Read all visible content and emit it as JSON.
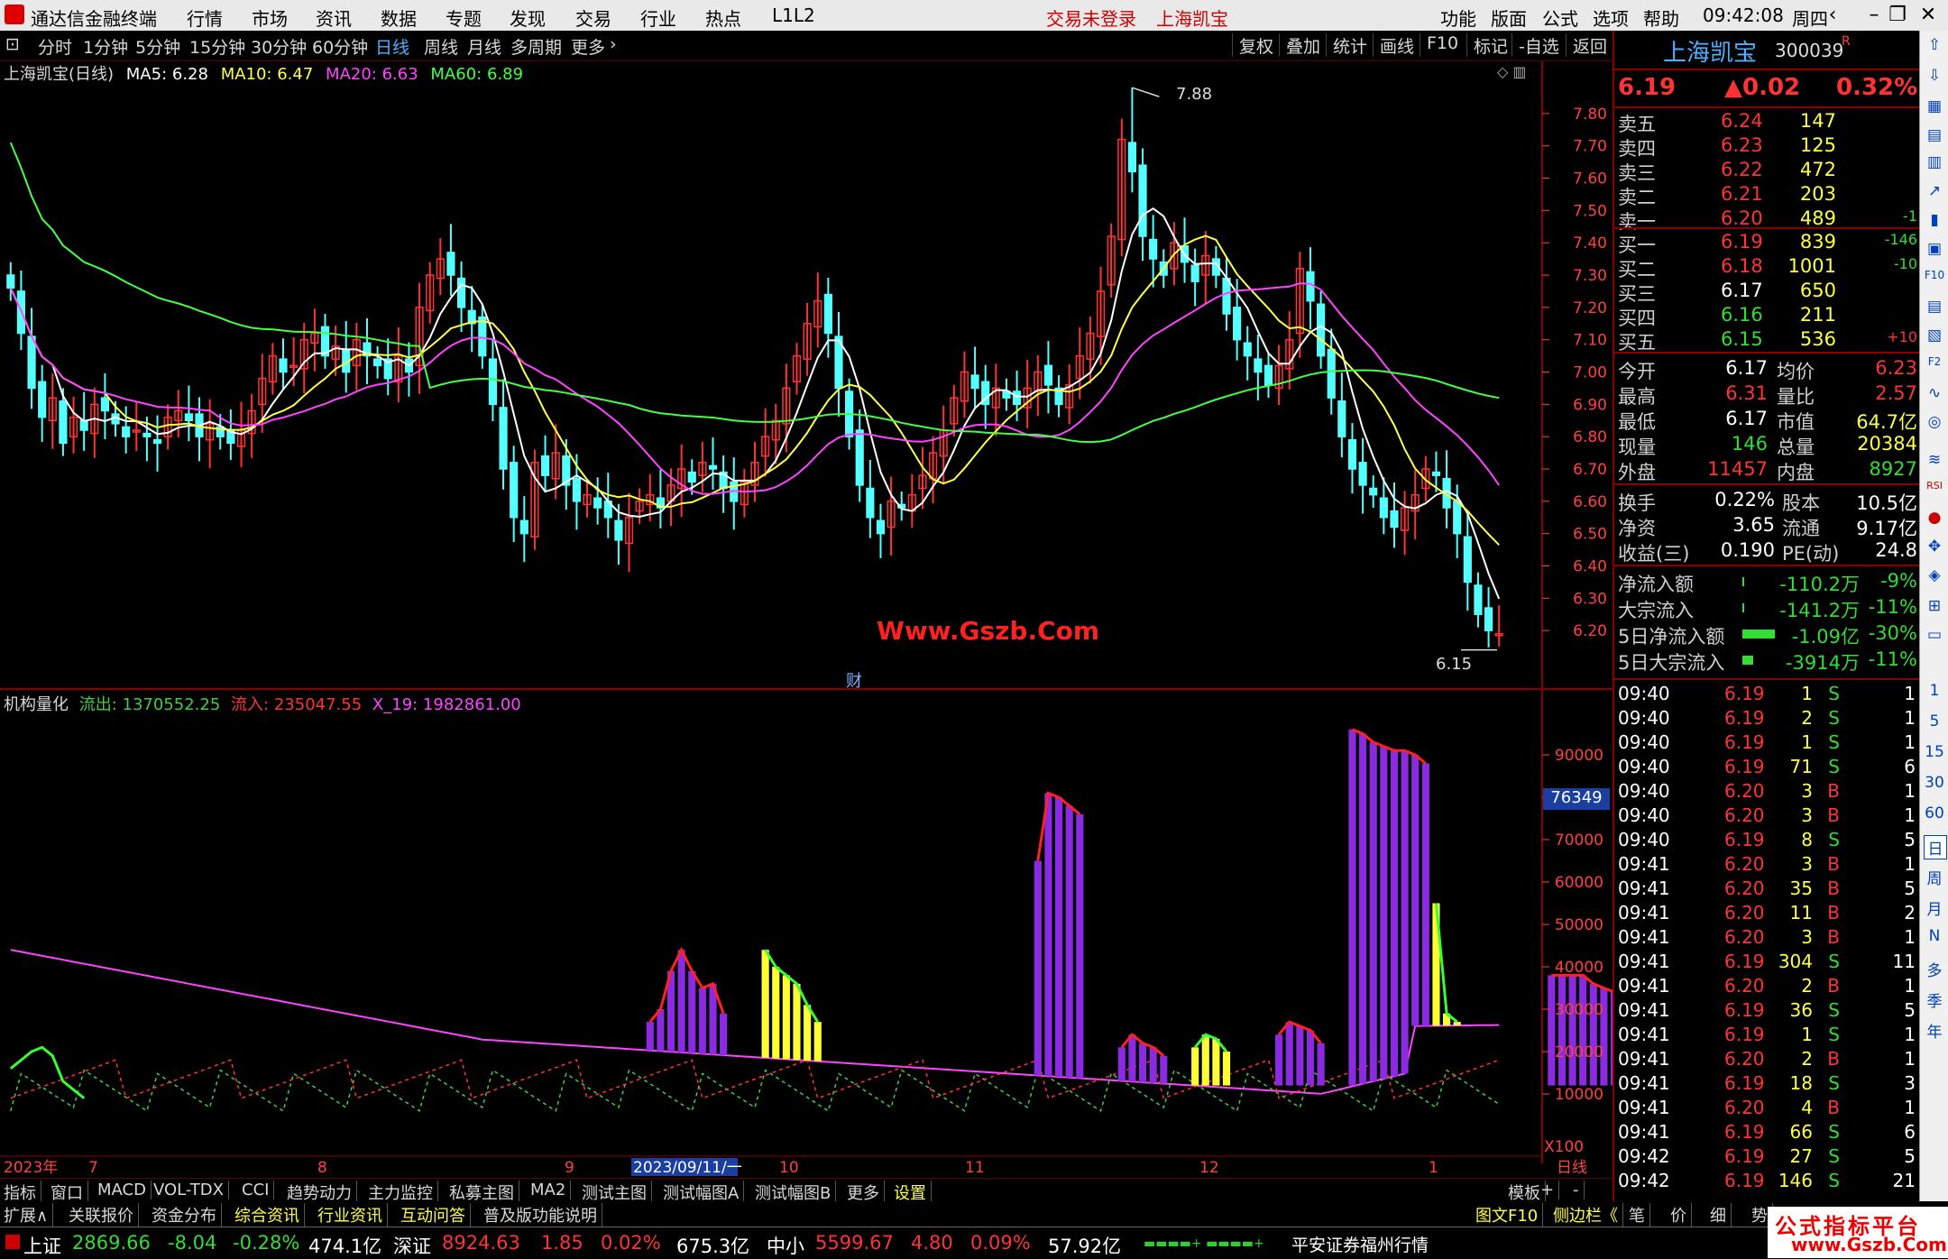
{
  "menubar": {
    "app_title": "通达信金融终端",
    "menus": [
      "行情",
      "市场",
      "资讯",
      "数据",
      "专题",
      "发现",
      "交易",
      "行业",
      "热点",
      "L1L2"
    ],
    "login_status": "交易未登录",
    "stock_name": "上海凯宝",
    "right_menus": [
      "功能",
      "版面",
      "公式",
      "选项",
      "帮助"
    ],
    "time": "09:42:08",
    "weekday": "周四"
  },
  "period_bar": {
    "periods": [
      "分时",
      "1分钟",
      "5分钟",
      "15分钟",
      "30分钟",
      "60分钟",
      "日线",
      "周线",
      "月线",
      "多周期",
      "更多"
    ],
    "active": "日线",
    "buttons": [
      "复权",
      "叠加",
      "统计",
      "画线",
      "F10",
      "标记",
      "-自选",
      "返回"
    ]
  },
  "main_chart": {
    "title": "上海凯宝(日线)",
    "ma_legend": [
      {
        "label": "MA5: 6.28",
        "color": "#ffffff"
      },
      {
        "label": "MA10: 6.47",
        "color": "#ffff44"
      },
      {
        "label": "MA20: 6.63",
        "color": "#ff44ff"
      },
      {
        "label": "MA60: 6.89",
        "color": "#44ff44"
      }
    ],
    "high_marker": "7.88",
    "low_marker": "6.15",
    "watermark": "Www.Gszb.Com",
    "finance_tag": "财"
  },
  "chart_data": [
    {
      "type": "candlestick",
      "title": "上海凯宝(日线)",
      "y_ticks": [
        6.2,
        6.3,
        6.4,
        6.5,
        6.6,
        6.7,
        6.8,
        6.9,
        7.0,
        7.1,
        7.2,
        7.3,
        7.4,
        7.5,
        7.6,
        7.7,
        7.8
      ],
      "ylim": [
        6.1,
        7.9
      ],
      "x_ticks": [
        "2023年",
        "7",
        "8",
        "9",
        "2023/09/11/一",
        "10",
        "11",
        "12",
        "1",
        "日线"
      ],
      "close_series": [
        7.26,
        7.12,
        6.95,
        6.86,
        6.92,
        6.78,
        6.86,
        6.82,
        6.9,
        6.88,
        6.84,
        6.8,
        6.82,
        6.8,
        6.78,
        6.86,
        6.88,
        6.85,
        6.8,
        6.84,
        6.8,
        6.78,
        6.82,
        6.88,
        6.98,
        7.05,
        7.0,
        7.02,
        7.1,
        7.12,
        7.05,
        7.08,
        7.0,
        7.1,
        7.05,
        7.02,
        6.98,
        7.05,
        7.0,
        7.2,
        7.3,
        7.35,
        7.3,
        7.2,
        7.15,
        7.05,
        6.9,
        6.7,
        6.55,
        6.5,
        6.72,
        6.68,
        6.75,
        6.65,
        6.6,
        6.62,
        6.58,
        6.55,
        6.48,
        6.55,
        6.6,
        6.62,
        6.58,
        6.65,
        6.7,
        6.66,
        6.72,
        6.7,
        6.64,
        6.6,
        6.66,
        6.72,
        6.8,
        6.85,
        6.95,
        7.05,
        7.15,
        7.22,
        7.12,
        6.95,
        6.8,
        6.65,
        6.55,
        6.5,
        6.6,
        6.58,
        6.62,
        6.68,
        6.75,
        6.82,
        6.92,
        7.0,
        6.95,
        6.9,
        6.95,
        6.92,
        6.9,
        6.95,
        7.0,
        6.96,
        6.9,
        6.96,
        7.05,
        7.12,
        7.25,
        7.42,
        7.72,
        7.62,
        7.42,
        7.35,
        7.3,
        7.4,
        7.34,
        7.28,
        7.36,
        7.3,
        7.18,
        7.1,
        7.05,
        7.0,
        6.96,
        7.02,
        7.1,
        7.32,
        7.22,
        7.05,
        6.92,
        6.8,
        6.7,
        6.65,
        6.62,
        6.55,
        6.52,
        6.58,
        6.62,
        6.7,
        6.68,
        6.58,
        6.5,
        6.35,
        6.25,
        6.2,
        6.19
      ],
      "series": [
        {
          "name": "MA5",
          "color": "#ffffff",
          "last": 6.28
        },
        {
          "name": "MA10",
          "color": "#ffff44",
          "last": 6.47
        },
        {
          "name": "MA20",
          "color": "#ff44ff",
          "last": 6.63
        },
        {
          "name": "MA60",
          "color": "#44ff44",
          "last": 6.89
        }
      ],
      "annotations": [
        {
          "label": "7.88",
          "kind": "high"
        },
        {
          "label": "6.15",
          "kind": "low"
        }
      ]
    },
    {
      "type": "bar",
      "title": "机构量化",
      "legend": [
        {
          "label": "流出: 1370552.25",
          "color": "#44cc44"
        },
        {
          "label": "流入: 235047.55",
          "color": "#ff3333"
        },
        {
          "label": "X_19: 1982861.00",
          "color": "#ff44ff"
        }
      ],
      "y_ticks": [
        10000,
        20000,
        30000,
        40000,
        50000,
        60000,
        70000,
        80000,
        90000
      ],
      "ylim": [
        0,
        100000
      ],
      "y_unit": "X100",
      "current_value_tag": "76349",
      "purple_blocks": [
        {
          "start": 61,
          "values": [
            27000,
            30000,
            39000,
            44000,
            39000,
            35000,
            36000,
            29000
          ]
        },
        {
          "start": 98,
          "values": [
            65000,
            81000,
            80000,
            78000,
            76000
          ]
        },
        {
          "start": 128,
          "values": [
            96000,
            95000,
            93000,
            92000,
            91000,
            91000,
            90000,
            88000
          ]
        },
        {
          "start": 147,
          "values": [
            38000,
            38000,
            38000,
            38000,
            36000,
            35000,
            34000
          ]
        },
        {
          "start": 106,
          "values": [
            21000,
            24000,
            22000,
            21000,
            19000
          ]
        },
        {
          "start": 121,
          "values": [
            24000,
            27000,
            26000,
            25000,
            22000
          ]
        }
      ],
      "yellow_blocks": [
        {
          "start": 72,
          "values": [
            44000,
            40000,
            38000,
            36000,
            31000,
            27000
          ]
        },
        {
          "start": 113,
          "values": [
            21000,
            24000,
            23000,
            20000
          ]
        },
        {
          "start": 136,
          "values": [
            55000,
            29000,
            27000
          ]
        },
        {
          "start": 154,
          "values": [
            35000,
            29000
          ]
        }
      ],
      "x_ticks": [
        "2023年",
        "7",
        "8",
        "9",
        "2023/09/11/一",
        "10",
        "11",
        "12",
        "1",
        "日线"
      ]
    }
  ],
  "quote_panel": {
    "name": "上海凯宝",
    "code": "300039",
    "code_suffix": "R",
    "price": "6.19",
    "change": "▲0.02",
    "change_pct": "0.32%",
    "asks": [
      {
        "label": "卖五",
        "price": "6.24",
        "vol": "147",
        "chg": ""
      },
      {
        "label": "卖四",
        "price": "6.23",
        "vol": "125",
        "chg": ""
      },
      {
        "label": "卖三",
        "price": "6.22",
        "vol": "472",
        "chg": ""
      },
      {
        "label": "卖二",
        "price": "6.21",
        "vol": "203",
        "chg": ""
      },
      {
        "label": "卖一",
        "price": "6.20",
        "vol": "489",
        "chg": "-1"
      }
    ],
    "bids": [
      {
        "label": "买一",
        "price": "6.19",
        "vol": "839",
        "chg": "-146"
      },
      {
        "label": "买二",
        "price": "6.18",
        "vol": "1001",
        "chg": "-10"
      },
      {
        "label": "买三",
        "price": "6.17",
        "vol": "650",
        "chg": ""
      },
      {
        "label": "买四",
        "price": "6.16",
        "vol": "211",
        "chg": ""
      },
      {
        "label": "买五",
        "price": "6.15",
        "vol": "536",
        "chg": "+10"
      }
    ],
    "stats1": [
      {
        "l1": "今开",
        "v1": "6.17",
        "l2": "均价",
        "v2": "6.23"
      },
      {
        "l1": "最高",
        "v1": "6.31",
        "l2": "量比",
        "v2": "2.57"
      },
      {
        "l1": "最低",
        "v1": "6.17",
        "l2": "市值",
        "v2": "64.7亿"
      },
      {
        "l1": "现量",
        "v1": "146",
        "l2": "总量",
        "v2": "20384"
      },
      {
        "l1": "外盘",
        "v1": "11457",
        "l2": "内盘",
        "v2": "8927"
      }
    ],
    "stats2": [
      {
        "l1": "换手",
        "v1": "0.22%",
        "l2": "股本",
        "v2": "10.5亿"
      },
      {
        "l1": "净资",
        "v1": "3.65",
        "l2": "流通",
        "v2": "9.17亿"
      },
      {
        "l1": "收益(三)",
        "v1": "0.190",
        "l2": "PE(动)",
        "v2": "24.8"
      }
    ],
    "flows": [
      {
        "label": "净流入额",
        "value": "-110.2万",
        "pct": "-9%"
      },
      {
        "label": "大宗流入",
        "value": "-141.2万",
        "pct": "-11%"
      },
      {
        "label": "5日净流入额",
        "value": "-1.09亿",
        "pct": "-30%"
      },
      {
        "label": "5日大宗流入",
        "value": "-3914万",
        "pct": "-11%"
      }
    ],
    "ticks": [
      {
        "t": "09:40",
        "p": "6.19",
        "v": "1",
        "d": "S",
        "n": "1"
      },
      {
        "t": "09:40",
        "p": "6.19",
        "v": "2",
        "d": "S",
        "n": "1"
      },
      {
        "t": "09:40",
        "p": "6.19",
        "v": "1",
        "d": "S",
        "n": "1"
      },
      {
        "t": "09:40",
        "p": "6.19",
        "v": "71",
        "d": "S",
        "n": "6"
      },
      {
        "t": "09:40",
        "p": "6.20",
        "v": "3",
        "d": "B",
        "n": "1"
      },
      {
        "t": "09:40",
        "p": "6.20",
        "v": "3",
        "d": "B",
        "n": "1"
      },
      {
        "t": "09:40",
        "p": "6.19",
        "v": "8",
        "d": "S",
        "n": "5"
      },
      {
        "t": "09:41",
        "p": "6.20",
        "v": "3",
        "d": "B",
        "n": "1"
      },
      {
        "t": "09:41",
        "p": "6.20",
        "v": "35",
        "d": "B",
        "n": "5"
      },
      {
        "t": "09:41",
        "p": "6.20",
        "v": "11",
        "d": "B",
        "n": "2"
      },
      {
        "t": "09:41",
        "p": "6.20",
        "v": "3",
        "d": "B",
        "n": "1"
      },
      {
        "t": "09:41",
        "p": "6.19",
        "v": "304",
        "d": "S",
        "n": "11"
      },
      {
        "t": "09:41",
        "p": "6.20",
        "v": "2",
        "d": "B",
        "n": "1"
      },
      {
        "t": "09:41",
        "p": "6.19",
        "v": "36",
        "d": "S",
        "n": "5"
      },
      {
        "t": "09:41",
        "p": "6.19",
        "v": "1",
        "d": "S",
        "n": "1"
      },
      {
        "t": "09:41",
        "p": "6.20",
        "v": "2",
        "d": "B",
        "n": "1"
      },
      {
        "t": "09:41",
        "p": "6.19",
        "v": "18",
        "d": "S",
        "n": "3"
      },
      {
        "t": "09:41",
        "p": "6.20",
        "v": "4",
        "d": "B",
        "n": "1"
      },
      {
        "t": "09:41",
        "p": "6.19",
        "v": "66",
        "d": "S",
        "n": "6"
      },
      {
        "t": "09:42",
        "p": "6.19",
        "v": "27",
        "d": "S",
        "n": "5"
      },
      {
        "t": "09:42",
        "p": "6.19",
        "v": "146",
        "d": "S",
        "n": "21"
      }
    ]
  },
  "sidebar_items": [
    "1",
    "5",
    "15",
    "30",
    "60",
    "日",
    "周",
    "月",
    "N",
    "多",
    "季",
    "年"
  ],
  "indicator_tabs": [
    "指标",
    "窗口",
    "MACD",
    "VOL-TDX",
    "CCI",
    "趋势动力",
    "主力监控",
    "私募主图",
    "MA2",
    "测试主图",
    "测试幅图A",
    "测试幅图B",
    "更多",
    "设置"
  ],
  "indicator_tabs_right": [
    "模板",
    "+",
    "-"
  ],
  "info_tabs": [
    "扩展∧",
    "关联报价",
    "资金分布",
    "综合资讯",
    "行业资讯",
    "互动问答",
    "普及版功能说明"
  ],
  "info_tabs_right": [
    "图文F10",
    "侧边栏《",
    "笔",
    "价",
    "细",
    "势"
  ],
  "status_bar": {
    "sh_label": "上证",
    "sh_val": "2869.66",
    "sh_chg": "-8.04",
    "sh_pct": "-0.28%",
    "sh_amt": "474.1亿",
    "sz_label": "深证",
    "sz_val": "8924.63",
    "sz_chg": "1.85",
    "sz_pct": "0.02%",
    "sz_amt": "675.3亿",
    "zx_label": "中小",
    "zx_val": "5599.67",
    "zx_chg": "4.80",
    "zx_pct": "0.09%",
    "zx_amt": "57.92亿",
    "broker": "平安证券福州行情"
  },
  "bottom_watermark": "公式指标平台",
  "bottom_watermark_url": "www.Gszb.Com"
}
